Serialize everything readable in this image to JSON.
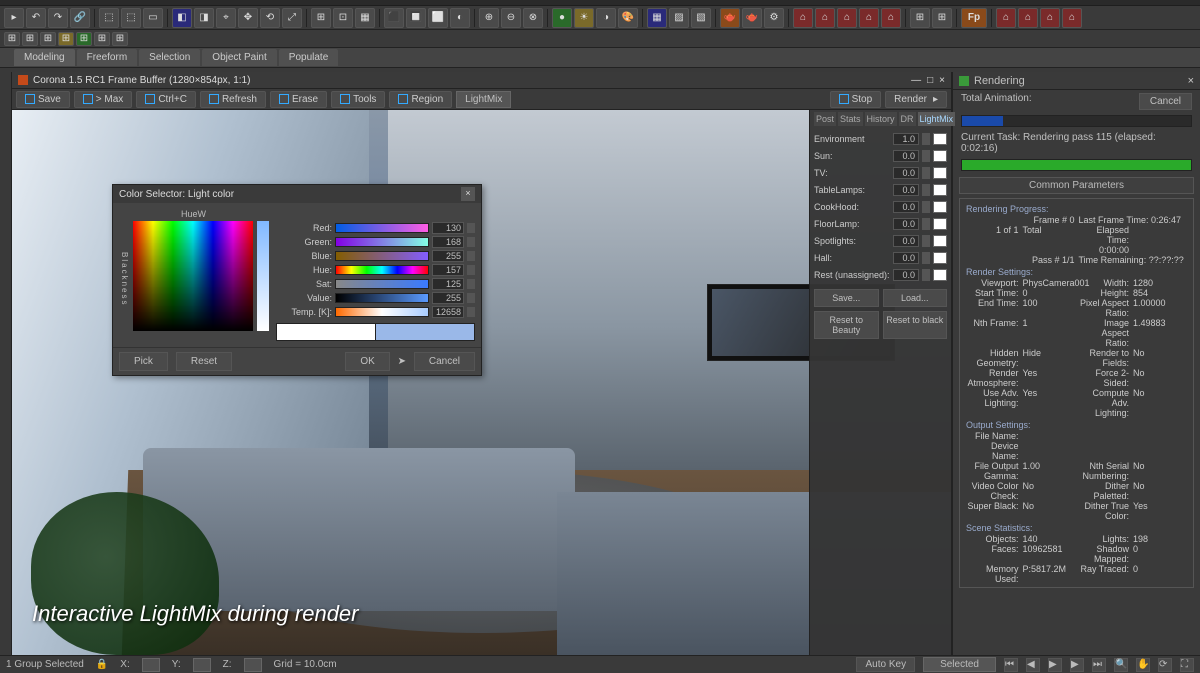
{
  "ribbon": {
    "tabs": [
      "Modeling",
      "Freeform",
      "Selection",
      "Object Paint",
      "Populate"
    ]
  },
  "frameBuffer": {
    "title": "Corona 1.5 RC1 Frame Buffer (1280×854px, 1:1)",
    "buttons": {
      "save": "Save",
      "toMax": "> Max",
      "ctrlC": "Ctrl+C",
      "refresh": "Refresh",
      "erase": "Erase",
      "tools": "Tools",
      "region": "Region",
      "layer": "LightMix",
      "stop": "Stop",
      "render": "Render"
    },
    "tabs": [
      "Post",
      "Stats",
      "History",
      "DR",
      "LightMix"
    ],
    "activeTab": "LightMix"
  },
  "lightmix": {
    "rows": [
      {
        "label": "Environment",
        "value": "1.0",
        "swatch": "#ffffff"
      },
      {
        "label": "Sun:",
        "value": "0.0",
        "swatch": "#ffffff"
      },
      {
        "label": "TV:",
        "value": "0.0",
        "swatch": "#ffffff"
      },
      {
        "label": "TableLamps:",
        "value": "0.0",
        "swatch": "#ffffff"
      },
      {
        "label": "CookHood:",
        "value": "0.0",
        "swatch": "#ffffff"
      },
      {
        "label": "FloorLamp:",
        "value": "0.0",
        "swatch": "#ffffff"
      },
      {
        "label": "Spotlights:",
        "value": "0.0",
        "swatch": "#ffffff"
      },
      {
        "label": "Hall:",
        "value": "0.0",
        "swatch": "#ffffff"
      },
      {
        "label": "Rest (unassigned):",
        "value": "0.0",
        "swatch": "#ffffff"
      }
    ],
    "saveBtn": "Save...",
    "loadBtn": "Load...",
    "resetBeauty": "Reset to Beauty",
    "resetBlack": "Reset to black"
  },
  "colorSelector": {
    "title": "Color Selector: Light color",
    "hueLabel": "Hue",
    "whitenessLabel": "W",
    "blacknessLabel": "Blackness",
    "sliders": [
      {
        "label": "Red:",
        "value": "130",
        "grad": "grad-r"
      },
      {
        "label": "Green:",
        "value": "168",
        "grad": "grad-g"
      },
      {
        "label": "Blue:",
        "value": "255",
        "grad": "grad-b"
      },
      {
        "label": "Hue:",
        "value": "157",
        "grad": "grad-h"
      },
      {
        "label": "Sat:",
        "value": "125",
        "grad": "grad-s"
      },
      {
        "label": "Value:",
        "value": "255",
        "grad": "grad-v"
      },
      {
        "label": "Temp. [K]:",
        "value": "12658",
        "grad": "grad-t"
      }
    ],
    "pick": "Pick",
    "reset": "Reset",
    "ok": "OK",
    "cancel": "Cancel"
  },
  "renderPanel": {
    "title": "Rendering",
    "cancel": "Cancel",
    "totalAnim": "Total Animation:",
    "currentTask": "Current Task:  Rendering pass 115 (elapsed: 0:02:16)",
    "commonHeader": "Common Parameters",
    "progress": {
      "title": "Rendering Progress:",
      "frame": {
        "k": "Frame # 0",
        "v": "Last Frame Time: 0:26:47"
      },
      "of": {
        "k": "1 of 1",
        "mid": "Total",
        "v": "Elapsed Time: 0:00:00"
      },
      "pass": {
        "k": "Pass # 1/1",
        "v": "Time Remaining: ??:??:??"
      }
    },
    "renderSettings": {
      "title": "Render Settings:",
      "rows": [
        {
          "l": "Viewport:",
          "lc": "PhysCamera001",
          "r": "Width:",
          "rc": "1280"
        },
        {
          "l": "Start Time:",
          "lc": "0",
          "r": "Height:",
          "rc": "854"
        },
        {
          "l": "End Time:",
          "lc": "100",
          "r": "Pixel Aspect Ratio:",
          "rc": "1.00000"
        },
        {
          "l": "Nth Frame:",
          "lc": "1",
          "r": "Image Aspect Ratio:",
          "rc": "1.49883"
        },
        {
          "l": "Hidden Geometry:",
          "lc": "Hide",
          "r": "Render to Fields:",
          "rc": "No"
        },
        {
          "l": "Render Atmosphere:",
          "lc": "Yes",
          "r": "Force 2-Sided:",
          "rc": "No"
        },
        {
          "l": "Use Adv. Lighting:",
          "lc": "Yes",
          "r": "Compute Adv. Lighting:",
          "rc": "No"
        }
      ]
    },
    "outputSettings": {
      "title": "Output Settings:",
      "rows": [
        {
          "l": "File Name:",
          "lc": "",
          "r": "",
          "rc": ""
        },
        {
          "l": "Device Name:",
          "lc": "",
          "r": "",
          "rc": ""
        },
        {
          "l": "File Output Gamma:",
          "lc": "1.00",
          "r": "Nth Serial Numbering:",
          "rc": "No"
        },
        {
          "l": "Video Color Check:",
          "lc": "No",
          "r": "Dither Paletted:",
          "rc": "No"
        },
        {
          "l": "Super Black:",
          "lc": "No",
          "r": "Dither True Color:",
          "rc": "Yes"
        }
      ]
    },
    "sceneStats": {
      "title": "Scene Statistics:",
      "rows": [
        {
          "l": "Objects:",
          "lc": "140",
          "r": "Lights:",
          "rc": "198"
        },
        {
          "l": "Faces:",
          "lc": "10962581",
          "r": "Shadow Mapped:",
          "rc": "0"
        },
        {
          "l": "Memory Used:",
          "lc": "P:5817.2M",
          "r": "Ray Traced:",
          "rc": "0"
        }
      ]
    }
  },
  "caption": "Interactive LightMix during render",
  "statusbar": {
    "selection": "1 Group Selected",
    "x": "X:",
    "y": "Y:",
    "z": "Z:",
    "grid": "Grid = 10.0cm",
    "autoKey": "Auto Key",
    "selected": "Selected"
  }
}
